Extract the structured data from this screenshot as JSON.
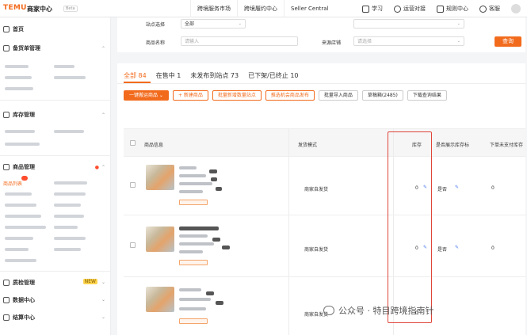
{
  "topbar": {
    "brand": "TEMU",
    "brand_sub": "商家中心",
    "brand_tag": "Beta",
    "nav": [
      "跨境服务市场",
      "跨境履约中心",
      "Seller Central"
    ],
    "right": [
      {
        "label": "学习",
        "icon": "book-icon"
      },
      {
        "label": "运营对接",
        "icon": "chat-icon"
      },
      {
        "label": "规则中心",
        "icon": "rules-icon"
      },
      {
        "label": "客服",
        "icon": "headset-icon"
      }
    ]
  },
  "sidebar": {
    "sections": [
      "首页",
      "备货单管理",
      "库存管理",
      "商品管理",
      "质检管理",
      "数据中心",
      "结算中心"
    ],
    "active_item": "商品列表"
  },
  "filters": {
    "shop_site_label": "站点选择",
    "shop_site_value": "全部",
    "product_name_label": "商品名称",
    "product_name_placeholder": "请输入",
    "source_label": "来源店铺",
    "source_placeholder": "请选择",
    "query_button": "查询"
  },
  "tabs": [
    {
      "label": "全部 84",
      "active": true
    },
    {
      "label": "在售中 1",
      "active": false
    },
    {
      "label": "未发布到站点 73",
      "active": false
    },
    {
      "label": "已下架/已终止 10",
      "active": false
    }
  ],
  "actions": [
    {
      "label": "一键搬运商品 ⌄",
      "style": "primary"
    },
    {
      "label": "+ 新建商品",
      "style": "outline"
    },
    {
      "label": "批量新增数量站点",
      "style": "outline"
    },
    {
      "label": "推选机会商品发布",
      "style": "outline"
    },
    {
      "label": "批量导入商品",
      "style": "gray"
    },
    {
      "label": "草稿箱(2485)",
      "style": "gray"
    },
    {
      "label": "下载查询结果",
      "style": "gray"
    }
  ],
  "table": {
    "columns": [
      "商品信息",
      "发货模式",
      "库存",
      "是否展示库存标",
      "下单未支付库存"
    ],
    "rows": [
      {
        "ship_mode": "商家自发货",
        "stock": "0",
        "show_flag": "是否",
        "unpaid": "0"
      },
      {
        "ship_mode": "商家自发货",
        "stock": "0",
        "show_flag": "是否",
        "unpaid": "0"
      },
      {
        "ship_mode": "商家自发货",
        "stock": "0",
        "show_flag": "",
        "unpaid": ""
      }
    ]
  },
  "watermark": "公众号 · 特目跨境指南针",
  "colors": {
    "accent": "#f26b1d",
    "highlight": "#e0453a",
    "link": "#4a7cf0"
  }
}
